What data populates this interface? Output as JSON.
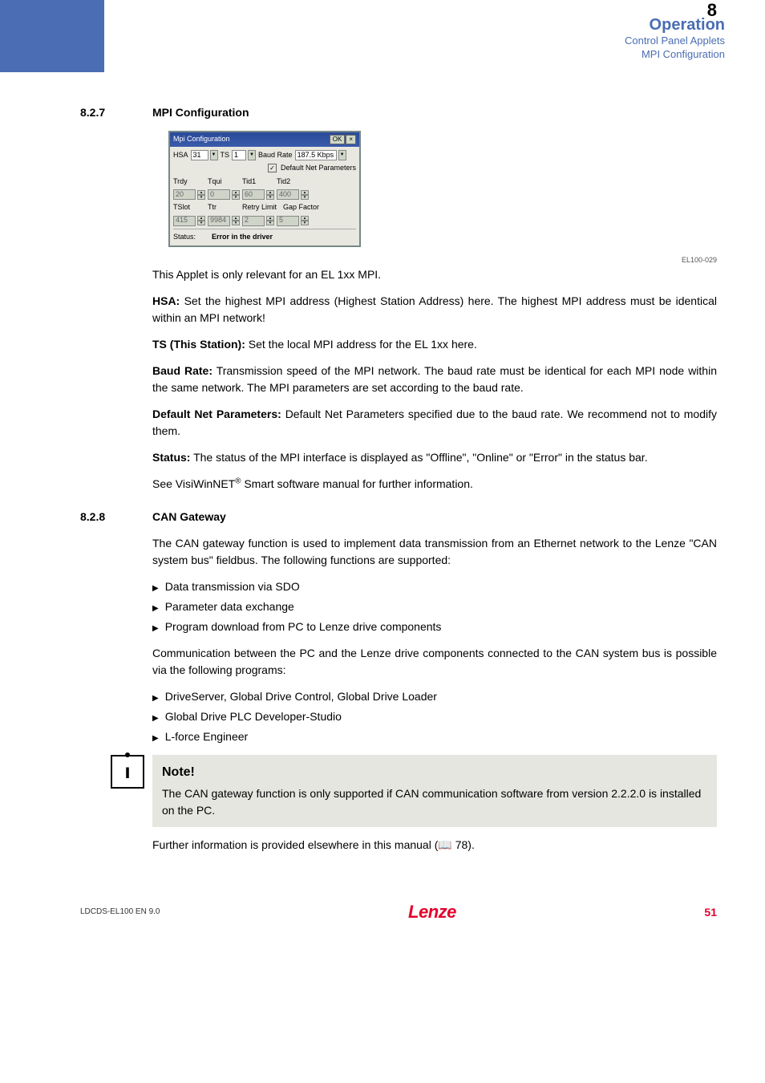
{
  "header": {
    "title": "Operation",
    "sub1": "Control Panel Applets",
    "sub2": "MPI Configuration",
    "chapter": "8"
  },
  "sec827": {
    "num": "8.2.7",
    "title": "MPI Configuration",
    "fig_code": "EL100-029",
    "dialog": {
      "title": "Mpi Configuration",
      "ok": "OK",
      "hsa_label": "HSA",
      "hsa_value": "31",
      "ts_label": "TS",
      "ts_value": "1",
      "baud_label": "Baud Rate",
      "baud_value": "187.5 Kbps",
      "default_check": "Default Net Parameters",
      "row_labels": [
        "Trdy",
        "Tqui",
        "Tid1",
        "Tid2"
      ],
      "row_values": [
        "20",
        "0",
        "60",
        "400"
      ],
      "row2_labels": [
        "TSlot",
        "Ttr",
        "Retry Limit",
        "Gap Factor"
      ],
      "row2_values": [
        "415",
        "9984",
        "2",
        "5"
      ],
      "status_label": "Status:",
      "status_value": "Error in the driver"
    },
    "p1": "This Applet is only relevant for an EL 1xx MPI.",
    "hsa_label": "HSA:",
    "hsa_text": "  Set the highest MPI address (Highest Station Address) here. The highest MPI address must be identical within an MPI network!",
    "ts_label": "TS (This Station):",
    "ts_text": "  Set the local MPI address for the EL 1xx here.",
    "baud_label": "Baud Rate:",
    "baud_text": "  Transmission speed of the MPI network. The baud rate must be identical for each MPI node within the same network. The MPI parameters are set according to the baud rate.",
    "def_label": "Default Net Parameters:",
    "def_text": "  Default Net Parameters specified due to the baud rate. We recommend not to modify them.",
    "status_label": "Status:",
    "status_text": "  The status of the MPI interface is displayed as \"Offline\", \"Online\" or \"Error\" in the status bar.",
    "see_pre": "See VisiWinNET",
    "see_sup": "®",
    "see_post": " Smart software manual for further information."
  },
  "sec828": {
    "num": "8.2.8",
    "title": "CAN Gateway",
    "p1": "The CAN gateway function is used to implement data transmission from an Ethernet network to the Lenze \"CAN system bus\" fieldbus. The following functions are supported:",
    "list1": [
      "Data transmission via SDO",
      "Parameter data exchange",
      "Program download from PC to Lenze drive components"
    ],
    "p2": "Communication between the PC and the Lenze drive components connected to the CAN system bus is possible via the following programs:",
    "list2": [
      "DriveServer, Global Drive Control, Global Drive Loader",
      "Global Drive PLC Developer-Studio",
      "L-force Engineer"
    ],
    "note_title": "Note!",
    "note_text": "The CAN gateway function is only supported if CAN communication software from version 2.2.2.0 is installed on the PC.",
    "further": "Further information is provided elsewhere in this manual (📖  78)."
  },
  "footer": {
    "left": "LDCDS-EL100  EN  9.0",
    "logo": "Lenze",
    "page": "51"
  }
}
